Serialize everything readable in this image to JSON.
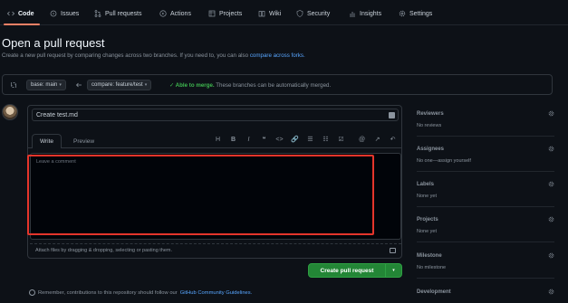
{
  "nav": {
    "tabs": [
      {
        "label": "Code",
        "icon": "code-icon",
        "active": true
      },
      {
        "label": "Issues",
        "icon": "issue-icon"
      },
      {
        "label": "Pull requests",
        "icon": "pull-request-icon"
      },
      {
        "label": "Actions",
        "icon": "play-icon"
      },
      {
        "label": "Projects",
        "icon": "table-icon"
      },
      {
        "label": "Wiki",
        "icon": "book-icon"
      },
      {
        "label": "Security",
        "icon": "shield-icon"
      },
      {
        "label": "Insights",
        "icon": "graph-icon"
      },
      {
        "label": "Settings",
        "icon": "gear-icon"
      }
    ]
  },
  "page": {
    "title": "Open a pull request",
    "subtitle": "Create a new pull request by comparing changes across two branches. If you need to, you can also",
    "subtitle_link": "compare across forks."
  },
  "compare": {
    "base_label": "base: main",
    "compare_label": "compare: feature/test",
    "merge_ok": "✓ Able to merge.",
    "merge_msg": "These branches can be automatically merged."
  },
  "editor": {
    "title_value": "Create test.md",
    "tab_write": "Write",
    "tab_preview": "Preview",
    "toolbar": [
      "H",
      "B",
      "I",
      "❝",
      "<>",
      "🔗",
      "☰",
      "☷",
      "☑",
      "@",
      "↗",
      "↶"
    ],
    "placeholder": "Leave a comment",
    "attach_text": "Attach files by dragging & dropping, selecting or pasting them."
  },
  "actions": {
    "create_label": "Create pull request",
    "create_caret": "▾"
  },
  "footer": {
    "text": "Remember, contributions to this repository should follow our",
    "link": "GitHub Community Guidelines."
  },
  "sidebar": {
    "sections": [
      {
        "head": "Reviewers",
        "value": "No reviews"
      },
      {
        "head": "Assignees",
        "value": "No one—assign yourself"
      },
      {
        "head": "Labels",
        "value": "None yet"
      },
      {
        "head": "Projects",
        "value": "None yet"
      },
      {
        "head": "Milestone",
        "value": "No milestone"
      },
      {
        "head": "Development",
        "value": ""
      }
    ]
  },
  "colors": {
    "accent_underline": "#f78166",
    "primary_button": "#238636",
    "highlight_border": "#e5352b",
    "link": "#58a6ff"
  }
}
